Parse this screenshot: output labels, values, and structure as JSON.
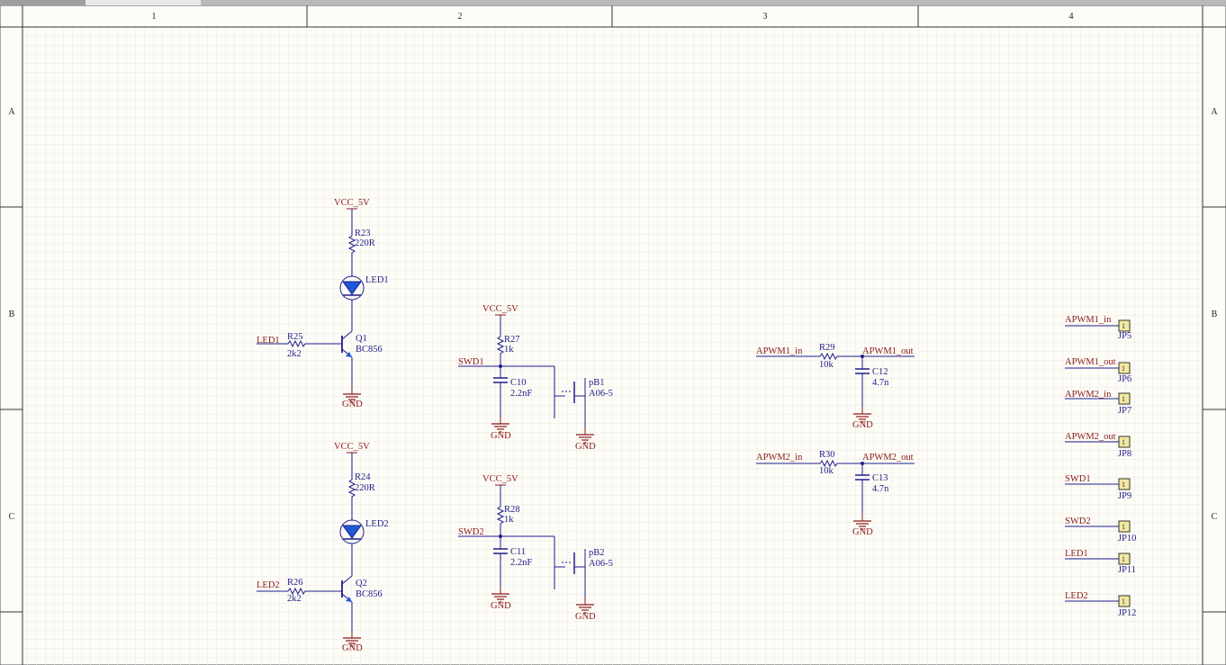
{
  "colors": {
    "wire": "#1e1e8c",
    "power": "#8b1a1a",
    "grid": "#ece9e0",
    "background": "#fdfcf7",
    "connector_fill": "#f3e99b"
  },
  "frame": {
    "columns": [
      "1",
      "2",
      "3",
      "4"
    ],
    "rows": [
      "A",
      "B",
      "C"
    ]
  },
  "power": {
    "vcc": "VCC_5V",
    "gnd": "GND"
  },
  "led_circuit_1": {
    "res_top": "R23",
    "res_top_val": "220R",
    "led": "LED1",
    "net": "LED1",
    "res_base": "R25",
    "res_base_val": "2k2",
    "transistor": "Q1",
    "transistor_val": "BC856"
  },
  "led_circuit_2": {
    "res_top": "R24",
    "res_top_val": "220R",
    "led": "LED2",
    "net": "LED2",
    "res_base": "R26",
    "res_base_val": "2k2",
    "transistor": "Q2",
    "transistor_val": "BC856"
  },
  "switch_circuit_1": {
    "net": "SWD1",
    "res": "R27",
    "res_val": "1k",
    "cap": "C10",
    "cap_val": "2.2nF",
    "button": "pB1",
    "button_val": "A06-5"
  },
  "switch_circuit_2": {
    "net": "SWD2",
    "res": "R28",
    "res_val": "1k",
    "cap": "C11",
    "cap_val": "2.2nF",
    "button": "pB2",
    "button_val": "A06-5"
  },
  "filter_1": {
    "in": "APWM1_in",
    "out": "APWM1_out",
    "res": "R29",
    "res_val": "10k",
    "cap": "C12",
    "cap_val": "4.7n"
  },
  "filter_2": {
    "in": "APWM2_in",
    "out": "APWM2_out",
    "res": "R30",
    "res_val": "10k",
    "cap": "C13",
    "cap_val": "4.7n"
  },
  "connectors": [
    {
      "net": "APWM1_in",
      "ref": "JP5",
      "pin": "1"
    },
    {
      "net": "APWM1_out",
      "ref": "JP6",
      "pin": "1"
    },
    {
      "net": "APWM2_in",
      "ref": "JP7",
      "pin": "1"
    },
    {
      "net": "APWM2_out",
      "ref": "JP8",
      "pin": "1"
    },
    {
      "net": "SWD1",
      "ref": "JP9",
      "pin": "1"
    },
    {
      "net": "SWD2",
      "ref": "JP10",
      "pin": "1"
    },
    {
      "net": "LED1",
      "ref": "JP11",
      "pin": "1"
    },
    {
      "net": "LED2",
      "ref": "JP12",
      "pin": "1"
    }
  ]
}
